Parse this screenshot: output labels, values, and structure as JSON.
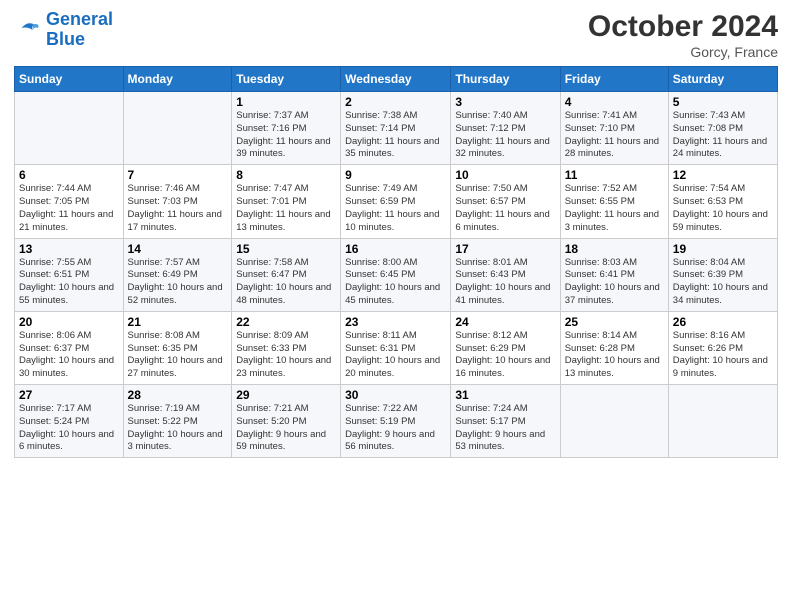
{
  "logo": {
    "line1": "General",
    "line2": "Blue"
  },
  "title": "October 2024",
  "location": "Gorcy, France",
  "header": {
    "days": [
      "Sunday",
      "Monday",
      "Tuesday",
      "Wednesday",
      "Thursday",
      "Friday",
      "Saturday"
    ]
  },
  "weeks": [
    [
      {
        "day": "",
        "info": ""
      },
      {
        "day": "",
        "info": ""
      },
      {
        "day": "1",
        "info": "Sunrise: 7:37 AM\nSunset: 7:16 PM\nDaylight: 11 hours and 39 minutes."
      },
      {
        "day": "2",
        "info": "Sunrise: 7:38 AM\nSunset: 7:14 PM\nDaylight: 11 hours and 35 minutes."
      },
      {
        "day": "3",
        "info": "Sunrise: 7:40 AM\nSunset: 7:12 PM\nDaylight: 11 hours and 32 minutes."
      },
      {
        "day": "4",
        "info": "Sunrise: 7:41 AM\nSunset: 7:10 PM\nDaylight: 11 hours and 28 minutes."
      },
      {
        "day": "5",
        "info": "Sunrise: 7:43 AM\nSunset: 7:08 PM\nDaylight: 11 hours and 24 minutes."
      }
    ],
    [
      {
        "day": "6",
        "info": "Sunrise: 7:44 AM\nSunset: 7:05 PM\nDaylight: 11 hours and 21 minutes."
      },
      {
        "day": "7",
        "info": "Sunrise: 7:46 AM\nSunset: 7:03 PM\nDaylight: 11 hours and 17 minutes."
      },
      {
        "day": "8",
        "info": "Sunrise: 7:47 AM\nSunset: 7:01 PM\nDaylight: 11 hours and 13 minutes."
      },
      {
        "day": "9",
        "info": "Sunrise: 7:49 AM\nSunset: 6:59 PM\nDaylight: 11 hours and 10 minutes."
      },
      {
        "day": "10",
        "info": "Sunrise: 7:50 AM\nSunset: 6:57 PM\nDaylight: 11 hours and 6 minutes."
      },
      {
        "day": "11",
        "info": "Sunrise: 7:52 AM\nSunset: 6:55 PM\nDaylight: 11 hours and 3 minutes."
      },
      {
        "day": "12",
        "info": "Sunrise: 7:54 AM\nSunset: 6:53 PM\nDaylight: 10 hours and 59 minutes."
      }
    ],
    [
      {
        "day": "13",
        "info": "Sunrise: 7:55 AM\nSunset: 6:51 PM\nDaylight: 10 hours and 55 minutes."
      },
      {
        "day": "14",
        "info": "Sunrise: 7:57 AM\nSunset: 6:49 PM\nDaylight: 10 hours and 52 minutes."
      },
      {
        "day": "15",
        "info": "Sunrise: 7:58 AM\nSunset: 6:47 PM\nDaylight: 10 hours and 48 minutes."
      },
      {
        "day": "16",
        "info": "Sunrise: 8:00 AM\nSunset: 6:45 PM\nDaylight: 10 hours and 45 minutes."
      },
      {
        "day": "17",
        "info": "Sunrise: 8:01 AM\nSunset: 6:43 PM\nDaylight: 10 hours and 41 minutes."
      },
      {
        "day": "18",
        "info": "Sunrise: 8:03 AM\nSunset: 6:41 PM\nDaylight: 10 hours and 37 minutes."
      },
      {
        "day": "19",
        "info": "Sunrise: 8:04 AM\nSunset: 6:39 PM\nDaylight: 10 hours and 34 minutes."
      }
    ],
    [
      {
        "day": "20",
        "info": "Sunrise: 8:06 AM\nSunset: 6:37 PM\nDaylight: 10 hours and 30 minutes."
      },
      {
        "day": "21",
        "info": "Sunrise: 8:08 AM\nSunset: 6:35 PM\nDaylight: 10 hours and 27 minutes."
      },
      {
        "day": "22",
        "info": "Sunrise: 8:09 AM\nSunset: 6:33 PM\nDaylight: 10 hours and 23 minutes."
      },
      {
        "day": "23",
        "info": "Sunrise: 8:11 AM\nSunset: 6:31 PM\nDaylight: 10 hours and 20 minutes."
      },
      {
        "day": "24",
        "info": "Sunrise: 8:12 AM\nSunset: 6:29 PM\nDaylight: 10 hours and 16 minutes."
      },
      {
        "day": "25",
        "info": "Sunrise: 8:14 AM\nSunset: 6:28 PM\nDaylight: 10 hours and 13 minutes."
      },
      {
        "day": "26",
        "info": "Sunrise: 8:16 AM\nSunset: 6:26 PM\nDaylight: 10 hours and 9 minutes."
      }
    ],
    [
      {
        "day": "27",
        "info": "Sunrise: 7:17 AM\nSunset: 5:24 PM\nDaylight: 10 hours and 6 minutes."
      },
      {
        "day": "28",
        "info": "Sunrise: 7:19 AM\nSunset: 5:22 PM\nDaylight: 10 hours and 3 minutes."
      },
      {
        "day": "29",
        "info": "Sunrise: 7:21 AM\nSunset: 5:20 PM\nDaylight: 9 hours and 59 minutes."
      },
      {
        "day": "30",
        "info": "Sunrise: 7:22 AM\nSunset: 5:19 PM\nDaylight: 9 hours and 56 minutes."
      },
      {
        "day": "31",
        "info": "Sunrise: 7:24 AM\nSunset: 5:17 PM\nDaylight: 9 hours and 53 minutes."
      },
      {
        "day": "",
        "info": ""
      },
      {
        "day": "",
        "info": ""
      }
    ]
  ]
}
